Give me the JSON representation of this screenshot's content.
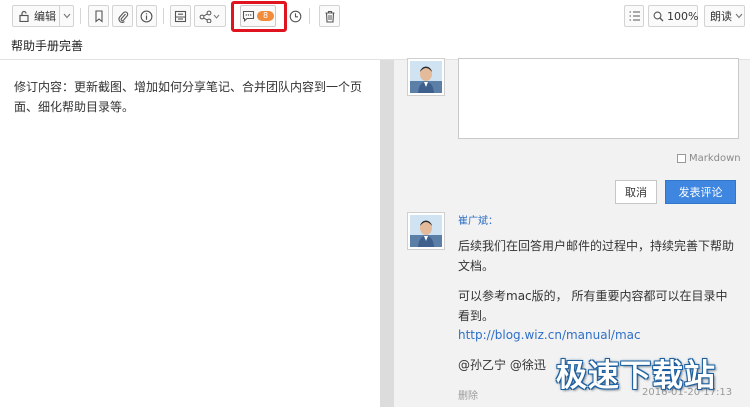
{
  "toolbar": {
    "edit_label": "编辑",
    "zoom_label": "100%",
    "read_label": "朗读",
    "comment_count": "8"
  },
  "document": {
    "title": "帮助手册完善",
    "content": "修订内容：更新截图、增加如何分享笔记、合并团队内容到一个页面、细化帮助目录等。"
  },
  "comment_panel": {
    "markdown_label": "Markdown",
    "cancel_label": "取消",
    "submit_label": "发表评论",
    "comment": {
      "author": "崔广斌：",
      "paragraph1": "后续我们在回答用户邮件的过程中，持续完善下帮助文档。",
      "paragraph2": "可以参考mac版的， 所有重要内容都可以在目录中看到。",
      "link": "http://blog.wiz.cn/manual/mac",
      "mentions": "@孙乙宁 @徐迅",
      "delete_label": "删除",
      "date": "2016-01-20 17:13"
    }
  },
  "watermark": {
    "text": "极速下载站"
  },
  "colors": {
    "accent_blue": "#3f86e0",
    "highlight_red": "#e0141e",
    "link_blue": "#2f6fc6",
    "badge_orange": "#f08c3c"
  }
}
